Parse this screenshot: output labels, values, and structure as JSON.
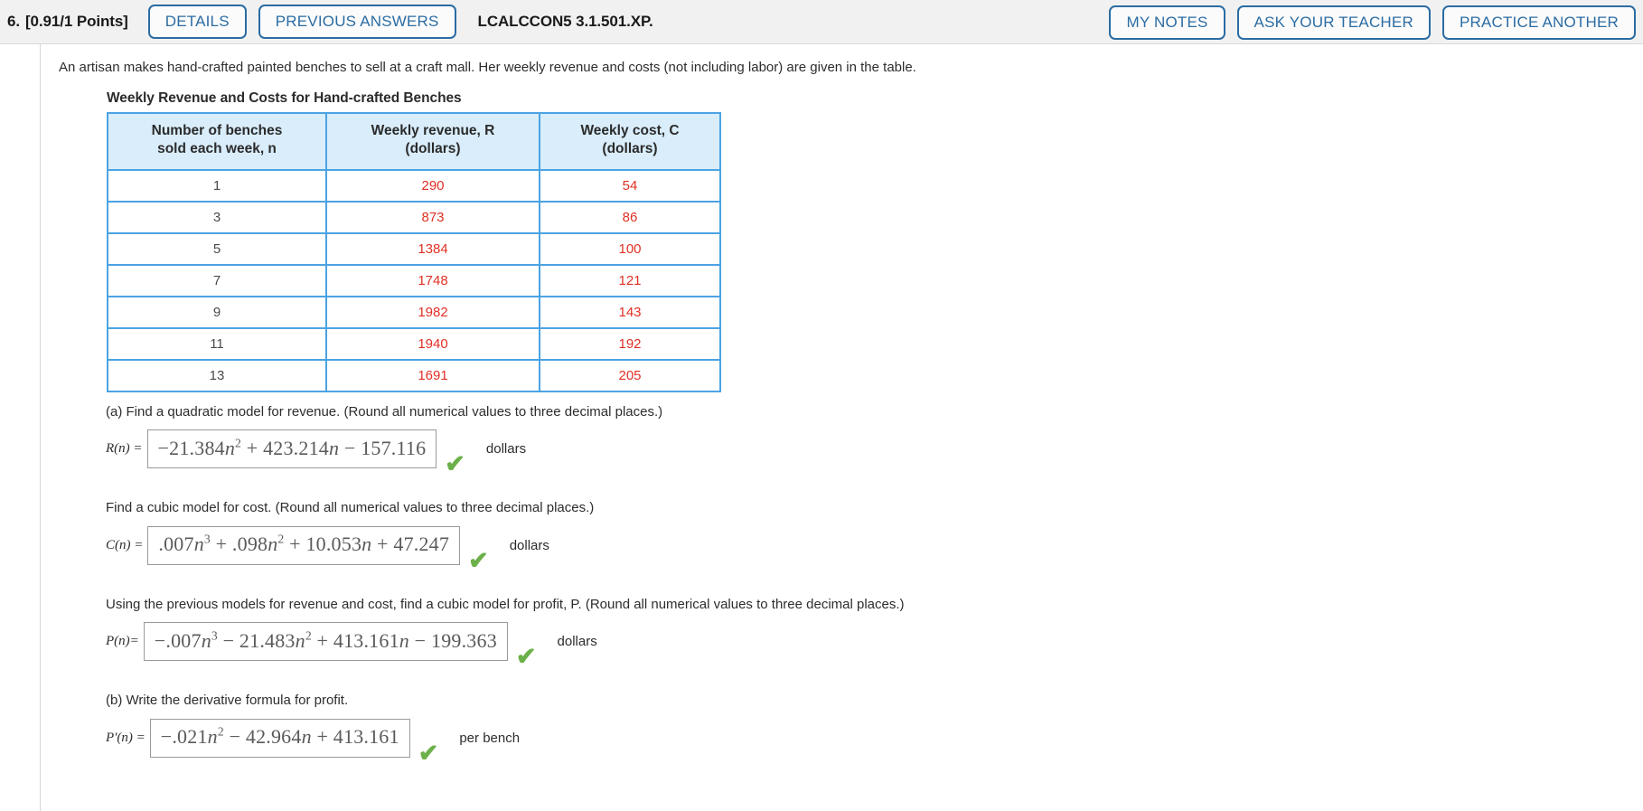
{
  "header": {
    "question_number": "6.",
    "points": "[0.91/1 Points]",
    "details_label": "DETAILS",
    "previous_answers_label": "PREVIOUS ANSWERS",
    "problem_code": "LCALCCON5 3.1.501.XP.",
    "my_notes_label": "MY NOTES",
    "ask_teacher_label": "ASK YOUR TEACHER",
    "practice_another_label": "PRACTICE ANOTHER",
    "accent_color": "#2b6ca3"
  },
  "problem": {
    "intro": "An artisan makes hand-crafted painted benches to sell at a craft mall. Her weekly revenue and costs (not including labor) are given in the table."
  },
  "table": {
    "caption": "Weekly Revenue and Costs for Hand-crafted Benches",
    "headers": [
      {
        "line1": "Number of benches",
        "line2": "sold each week, n"
      },
      {
        "line1": "Weekly revenue, R",
        "line2": "(dollars)"
      },
      {
        "line1": "Weekly cost, C",
        "line2": "(dollars)"
      }
    ],
    "header_bg": "#d9edfb",
    "border_color": "#4ba3e3",
    "value_color": "#e03025",
    "rows": [
      {
        "n": "1",
        "revenue": "290",
        "cost": "54"
      },
      {
        "n": "3",
        "revenue": "873",
        "cost": "86"
      },
      {
        "n": "5",
        "revenue": "1384",
        "cost": "100"
      },
      {
        "n": "7",
        "revenue": "1748",
        "cost": "121"
      },
      {
        "n": "9",
        "revenue": "1982",
        "cost": "143"
      },
      {
        "n": "11",
        "revenue": "1940",
        "cost": "192"
      },
      {
        "n": "13",
        "revenue": "1691",
        "cost": "205"
      }
    ]
  },
  "parts": {
    "a_revenue": {
      "prompt": "(a) Find a quadratic model for revenue. (Round all numerical values to three decimal places.)",
      "fn_label": "R(n) =",
      "answer_plain": "−21.384n² + 423.214n − 157.116",
      "unit": "dollars",
      "status": "correct",
      "check_glyph": "✔"
    },
    "a_cost": {
      "prompt": "Find a cubic model for cost. (Round all numerical values to three decimal places.)",
      "fn_label": "C(n) =",
      "answer_plain": ".007n³ + .098n² + 10.053n + 47.247",
      "unit": "dollars",
      "status": "correct",
      "check_glyph": "✔"
    },
    "a_profit": {
      "prompt": "Using the previous models for revenue and cost, find a cubic model for profit, P. (Round all numerical values to three decimal places.)",
      "fn_label": "P(n)=",
      "answer_plain": "−.007n³ − 21.483n² + 413.161n − 199.363",
      "unit": "dollars",
      "status": "correct",
      "check_glyph": "✔"
    },
    "b_derivative": {
      "prompt": "(b) Write the derivative formula for profit.",
      "fn_label": "P'(n) =",
      "answer_plain": "−.021n² − 42.964n + 413.161",
      "unit": "per bench",
      "status": "correct",
      "check_glyph": "✔"
    }
  }
}
